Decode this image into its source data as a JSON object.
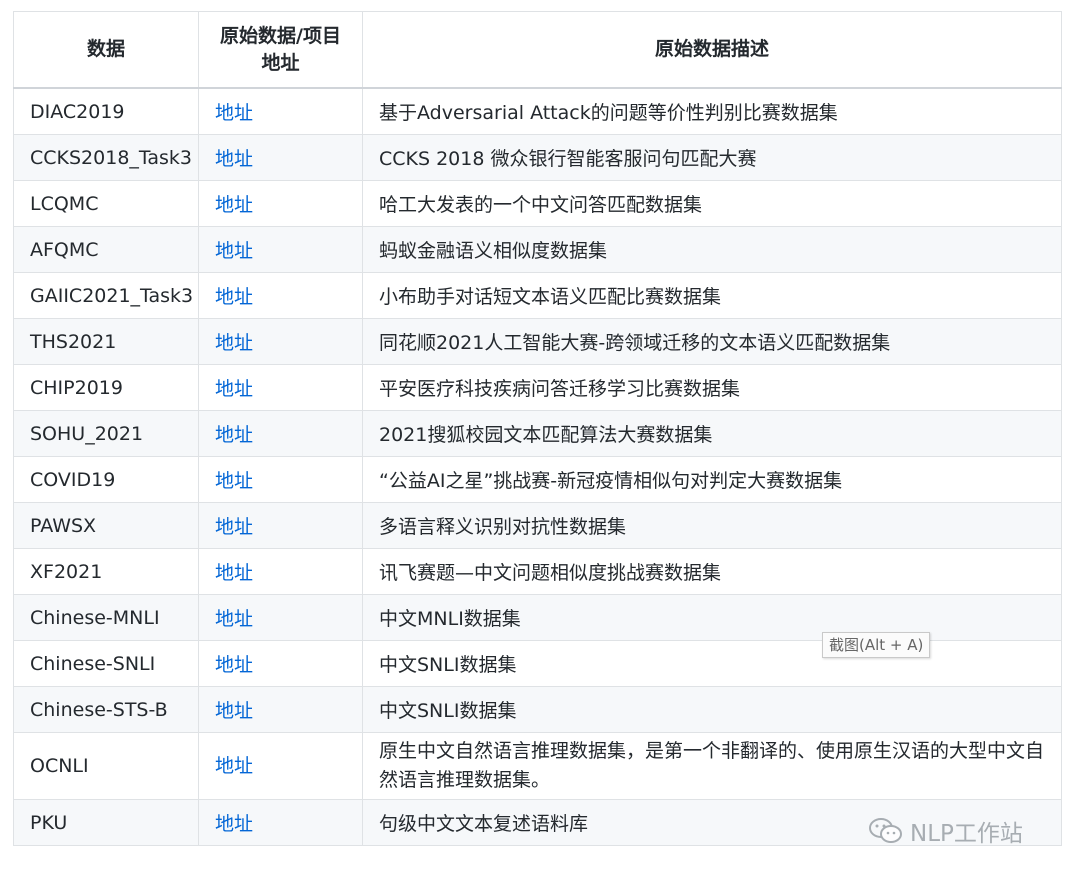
{
  "table": {
    "headers": [
      "数据",
      "原始数据/项目\n地址",
      "原始数据描述"
    ],
    "header_line1": "原始数据/项目",
    "header_line2": "地址",
    "rows": [
      {
        "name": "DIAC2019",
        "link": "地址",
        "desc": "基于Adversarial Attack的问题等价性判别比赛数据集"
      },
      {
        "name": "CCKS2018_Task3",
        "link": "地址",
        "desc": "CCKS 2018 微众银行智能客服问句匹配大赛"
      },
      {
        "name": "LCQMC",
        "link": "地址",
        "desc": "哈工大发表的一个中文问答匹配数据集"
      },
      {
        "name": "AFQMC",
        "link": "地址",
        "desc": "蚂蚁金融语义相似度数据集"
      },
      {
        "name": "GAIIC2021_Task3",
        "link": "地址",
        "desc": "小布助手对话短文本语义匹配比赛数据集"
      },
      {
        "name": "THS2021",
        "link": "地址",
        "desc": "同花顺2021人工智能大赛-跨领域迁移的文本语义匹配数据集"
      },
      {
        "name": "CHIP2019",
        "link": "地址",
        "desc": "平安医疗科技疾病问答迁移学习比赛数据集"
      },
      {
        "name": "SOHU_2021",
        "link": "地址",
        "desc": "2021搜狐校园文本匹配算法大赛数据集"
      },
      {
        "name": "COVID19",
        "link": "地址",
        "desc": "“公益AI之星”挑战赛-新冠疫情相似句对判定大赛数据集"
      },
      {
        "name": "PAWSX",
        "link": "地址",
        "desc": "多语言释义识别对抗性数据集"
      },
      {
        "name": "XF2021",
        "link": "地址",
        "desc": "讯飞赛题—中文问题相似度挑战赛数据集"
      },
      {
        "name": "Chinese-MNLI",
        "link": "地址",
        "desc": "中文MNLI数据集"
      },
      {
        "name": "Chinese-SNLI",
        "link": "地址",
        "desc": "中文SNLI数据集"
      },
      {
        "name": "Chinese-STS-B",
        "link": "地址",
        "desc": "中文SNLI数据集"
      },
      {
        "name": "OCNLI",
        "link": "地址",
        "desc": "原生中文自然语言推理数据集，是第一个非翻译的、使用原生汉语的大型中文自然语言推理数据集。"
      },
      {
        "name": "PKU",
        "link": "地址",
        "desc": "句级中文文本复述语料库"
      }
    ]
  },
  "tooltip": {
    "text": "截图(Alt + A)"
  },
  "watermark": {
    "text": "NLP工作站",
    "icon": "wechat-icon"
  },
  "colors": {
    "link": "#0366d6",
    "border": "#dfe2e5",
    "stripe": "#f6f8fa"
  }
}
